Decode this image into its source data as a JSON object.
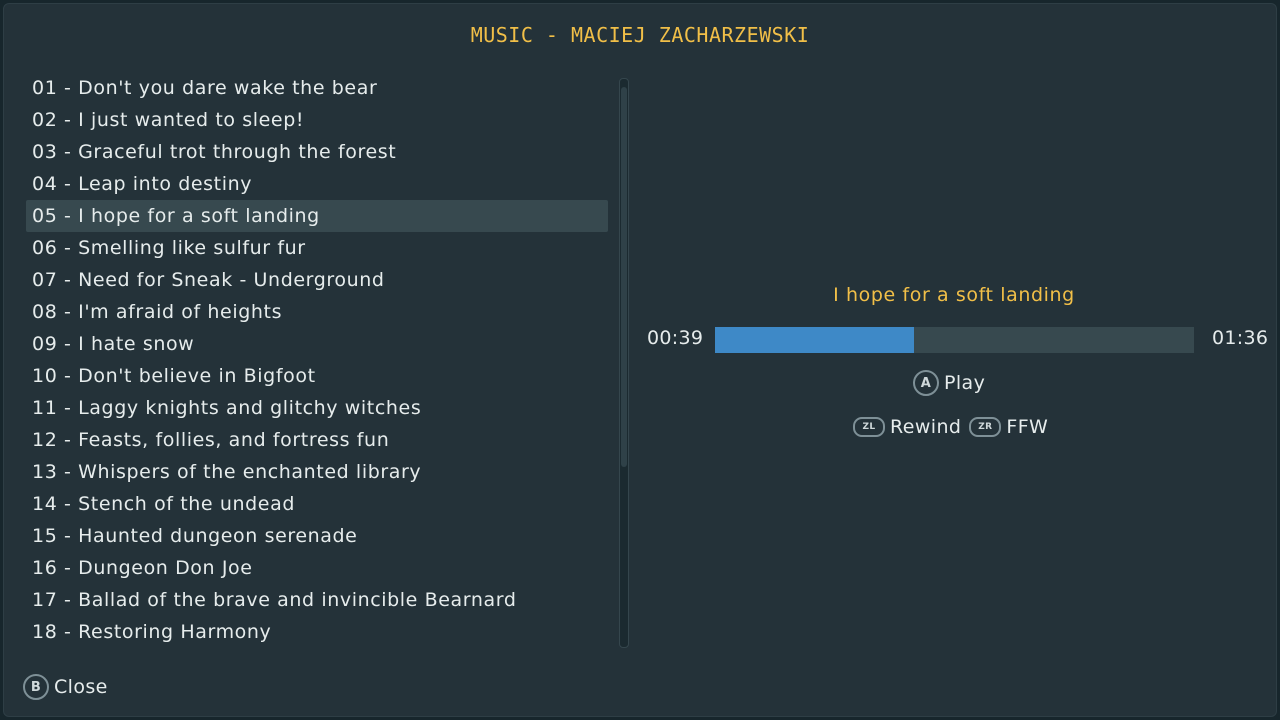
{
  "header": {
    "title": "MUSIC - MACIEJ ZACHARZEWSKI"
  },
  "tracks": [
    "01 - Don't you dare wake the bear",
    "02 - I just wanted to sleep!",
    "03 - Graceful trot through the forest",
    "04 - Leap into destiny",
    "05 - I hope for a soft landing",
    "06 - Smelling like sulfur fur",
    "07 - Need for Sneak - Underground",
    "08 - I'm afraid of heights",
    "09 - I hate snow",
    "10 - Don't believe in Bigfoot",
    "11 - Laggy knights and glitchy witches",
    "12 - Feasts, follies, and fortress fun",
    "13 - Whispers of the enchanted library",
    "14 - Stench of the undead",
    "15 - Haunted dungeon serenade",
    "16 - Dungeon Don Joe",
    "17 - Ballad of the brave and invincible Bearnard",
    "18 - Restoring Harmony"
  ],
  "selected_index": 4,
  "player": {
    "now_playing": "I hope for a soft landing",
    "elapsed": "00:39",
    "total": "01:36",
    "progress_fraction": 0.415,
    "play_button_glyph": "A",
    "play_label": "Play",
    "rewind_button_glyph": "ZL",
    "rewind_label": "Rewind",
    "ffw_button_glyph": "ZR",
    "ffw_label": "FFW"
  },
  "footer": {
    "close_button_glyph": "B",
    "close_label": "Close"
  },
  "colors": {
    "accent": "#f1bf48",
    "progress": "#3e89c7",
    "selection": "#37494f",
    "panel": "#243239"
  }
}
